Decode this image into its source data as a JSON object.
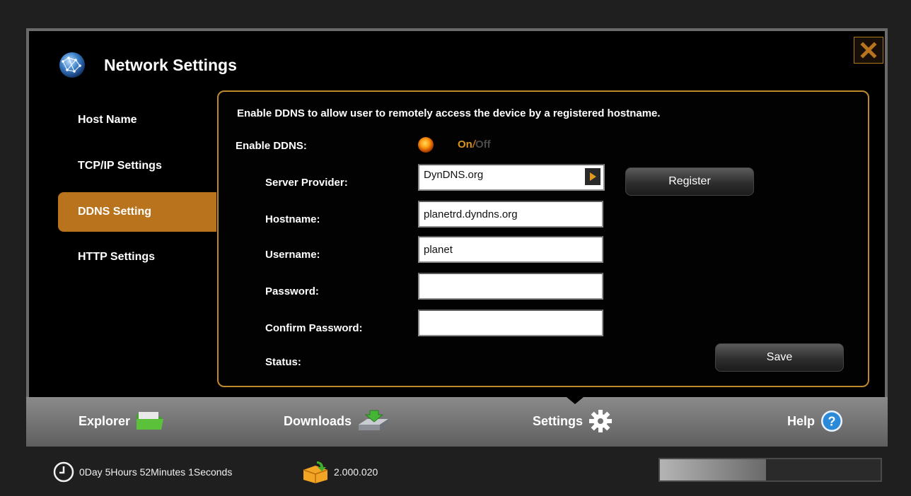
{
  "window": {
    "title": "Network Settings"
  },
  "sidebar": {
    "items": [
      {
        "label": "Host Name",
        "active": false
      },
      {
        "label": "TCP/IP Settings",
        "active": false
      },
      {
        "label": "DDNS Setting",
        "active": true
      },
      {
        "label": "HTTP Settings",
        "active": false
      }
    ]
  },
  "ddns": {
    "description": "Enable DDNS to allow user to remotely access the device by a registered hostname.",
    "enable_label": "Enable DDNS:",
    "toggle": {
      "on": "On",
      "separator": "/",
      "off": "Off",
      "state": "on"
    },
    "server_provider_label": "Server Provider:",
    "server_provider_value": "DynDNS.org",
    "register_label": "Register",
    "hostname_label": "Hostname:",
    "hostname_value": "planetrd.dyndns.org",
    "username_label": "Username:",
    "username_value": "planet",
    "password_label": "Password:",
    "password_value": "",
    "confirm_password_label": "Confirm Password:",
    "confirm_password_value": "",
    "status_label": "Status:",
    "save_label": "Save"
  },
  "footer": {
    "explorer_label": "Explorer",
    "downloads_label": "Downloads",
    "settings_label": "Settings",
    "help_label": "Help",
    "active": "settings"
  },
  "status_bar": {
    "uptime": "0Day 5Hours 52Minutes 1Seconds",
    "version": "2.000.020",
    "progress": 0.48
  },
  "colors": {
    "accent": "#b8731c",
    "panel_border": "#c08a2c",
    "help_blue": "#2a8ad8"
  },
  "icons": {
    "title": "globe-icon",
    "close": "close-icon",
    "select": "chevron-right-icon",
    "explorer": "folder-icon",
    "downloads": "download-icon",
    "settings": "gear-icon",
    "help": "help-icon",
    "uptime": "clock-icon",
    "version": "package-icon"
  }
}
